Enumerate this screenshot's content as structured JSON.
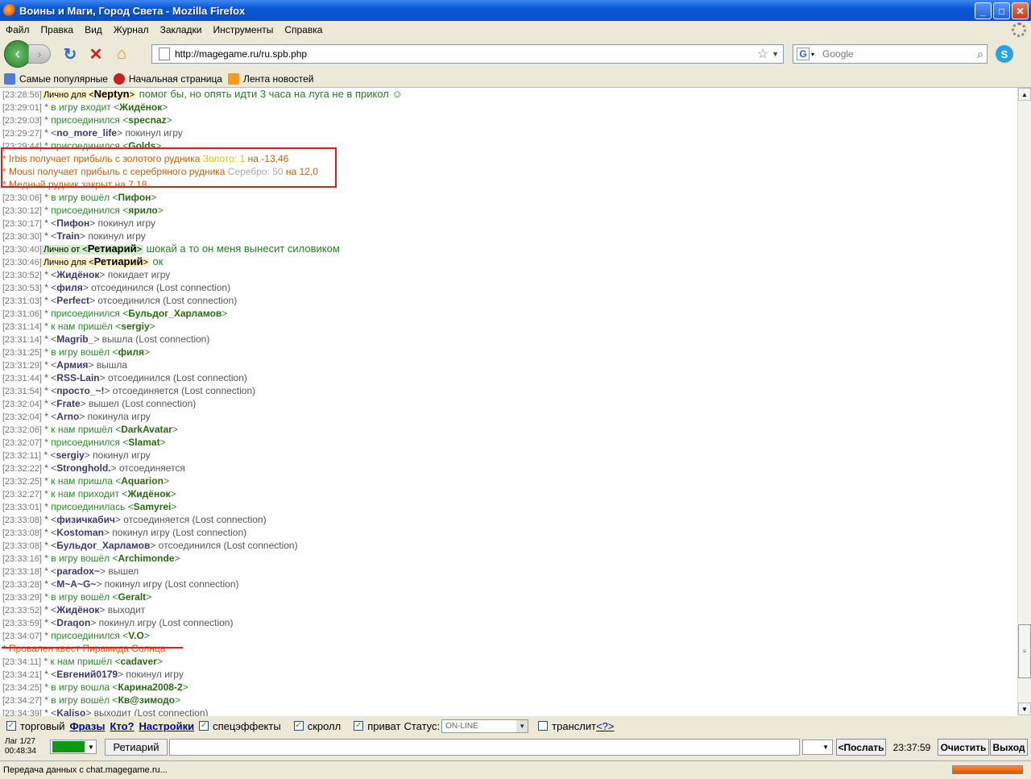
{
  "window": {
    "title": "Воины и Маги, Город Света - Mozilla Firefox",
    "minimize": "_",
    "maximize": "□",
    "close": "✕"
  },
  "menu": [
    "Файл",
    "Правка",
    "Вид",
    "Журнал",
    "Закладки",
    "Инструменты",
    "Справка"
  ],
  "nav": {
    "url": "http://magegame.ru/ru.spb.php",
    "search_placeholder": "Google"
  },
  "bookmarks": [
    "Самые популярные",
    "Начальная страница",
    "Лента новостей"
  ],
  "chat": [
    {
      "ts": "[23:28:56]",
      "type": "private_to",
      "label": "Лично для <",
      "nick": "Neptyn",
      "close": ">",
      "msg": " помог бы, но опять идти 3 часа на луга не в прикол ☺"
    },
    {
      "ts": "[23:29:01]",
      "type": "event",
      "pre": " * в игру входит <",
      "nick": "Жидёнок",
      "post": ">",
      "color": "green"
    },
    {
      "ts": "[23:29:03]",
      "type": "event",
      "pre": " * присоединился <",
      "nick": "specnaz",
      "post": ">",
      "color": "green"
    },
    {
      "ts": "[23:29:27]",
      "type": "event",
      "pre": " * <",
      "nick": "no_more_life",
      "post": "> покинул игру",
      "color": "gray"
    },
    {
      "ts": "[23:29:44]",
      "type": "event",
      "pre": " * присоединился <",
      "nick": "Golds",
      "post": ">",
      "color": "green"
    },
    {
      "ts": "",
      "type": "system",
      "text": "* Irbis получает прибыль с золотого рудника ",
      "hl": "Золото: 1",
      "hlclass": "gold",
      "tail": " на -13,46"
    },
    {
      "ts": "",
      "type": "system",
      "text": "* Mousi получает прибыль с серебряного рудника ",
      "hl": "Серебро: 50",
      "hlclass": "silver",
      "tail": " на 12,0"
    },
    {
      "ts": "",
      "type": "system",
      "text": "* Медный рудник закрыт на 7.18",
      "hl": "",
      "hlclass": "",
      "tail": ""
    },
    {
      "ts": "[23:30:06]",
      "type": "event",
      "pre": " * в игру вошёл <",
      "nick": "Пифон",
      "post": ">",
      "color": "green"
    },
    {
      "ts": "[23:30:12]",
      "type": "event",
      "pre": " * присоединился <",
      "nick": "ярило",
      "post": ">",
      "color": "green"
    },
    {
      "ts": "[23:30:17]",
      "type": "event",
      "pre": " * <",
      "nick": "Пифон",
      "post": "> покинул игру",
      "color": "gray"
    },
    {
      "ts": "[23:30:30]",
      "type": "event",
      "pre": " * <",
      "nick": "Train",
      "post": "> покинул игру",
      "color": "gray"
    },
    {
      "ts": "[23:30:40]",
      "type": "private_from",
      "label": "Лично от <",
      "nick": "Ретиарий",
      "close": ">",
      "msg": " шокай а то он меня вынесит силовиком"
    },
    {
      "ts": "[23:30:46]",
      "type": "private_to",
      "label": "Лично для <",
      "nick": "Ретиарий",
      "close": ">",
      "msg": " ок"
    },
    {
      "ts": "[23:30:52]",
      "type": "event",
      "pre": " * <",
      "nick": "Жидёнок",
      "post": "> покидает игру",
      "color": "gray"
    },
    {
      "ts": "[23:30:53]",
      "type": "event",
      "pre": " * <",
      "nick": "филя",
      "post": "> отсоединился (Lost connection)",
      "color": "gray"
    },
    {
      "ts": "[23:31:03]",
      "type": "event",
      "pre": " * <",
      "nick": "Perfect",
      "post": "> отсоединился (Lost connection)",
      "color": "gray"
    },
    {
      "ts": "[23:31:06]",
      "type": "event",
      "pre": " * присоединился <",
      "nick": "Бульдог_Харламов",
      "post": ">",
      "color": "green"
    },
    {
      "ts": "[23:31:14]",
      "type": "event",
      "pre": " * к нам пришёл <",
      "nick": "sergiy",
      "post": ">",
      "color": "green"
    },
    {
      "ts": "[23:31:14]",
      "type": "event",
      "pre": " * <",
      "nick": "Magrib_",
      "post": "> вышла (Lost connection)",
      "color": "gray"
    },
    {
      "ts": "[23:31:25]",
      "type": "event",
      "pre": " * в игру вошёл <",
      "nick": "филя",
      "post": ">",
      "color": "green"
    },
    {
      "ts": "[23:31:29]",
      "type": "event",
      "pre": " * <",
      "nick": "Армия",
      "post": "> вышла",
      "color": "gray"
    },
    {
      "ts": "[23:31:44]",
      "type": "event",
      "pre": " * <",
      "nick": "RSS-Lain",
      "post": "> отсоединился (Lost connection)",
      "color": "gray"
    },
    {
      "ts": "[23:31:54]",
      "type": "event",
      "pre": " * <",
      "nick": "просто_~!",
      "post": "> отсоединяется (Lost connection)",
      "color": "gray"
    },
    {
      "ts": "[23:32:04]",
      "type": "event",
      "pre": " * <",
      "nick": "Frate",
      "post": "> вышел (Lost connection)",
      "color": "gray"
    },
    {
      "ts": "[23:32:04]",
      "type": "event",
      "pre": " * <",
      "nick": "Arno",
      "post": "> покинула игру",
      "color": "gray"
    },
    {
      "ts": "[23:32:06]",
      "type": "event",
      "pre": " * к нам пришёл <",
      "nick": "DarkAvatar",
      "post": ">",
      "color": "green"
    },
    {
      "ts": "[23:32:07]",
      "type": "event",
      "pre": " * присоединился <",
      "nick": "Slamat",
      "post": ">",
      "color": "green"
    },
    {
      "ts": "[23:32:11]",
      "type": "event",
      "pre": " * <",
      "nick": "sergiy",
      "post": "> покинул игру",
      "color": "gray"
    },
    {
      "ts": "[23:32:22]",
      "type": "event",
      "pre": " * <",
      "nick": "Stronghold.",
      "post": "> отсоединяется",
      "color": "gray"
    },
    {
      "ts": "[23:32:25]",
      "type": "event",
      "pre": " * к нам пришла <",
      "nick": "Aquarion",
      "post": ">",
      "color": "green"
    },
    {
      "ts": "[23:32:27]",
      "type": "event",
      "pre": " * к нам приходит <",
      "nick": "Жидёнок",
      "post": ">",
      "color": "green"
    },
    {
      "ts": "[23:33:01]",
      "type": "event",
      "pre": " * присоединилась <",
      "nick": "Samyrei",
      "post": ">",
      "color": "green"
    },
    {
      "ts": "[23:33:08]",
      "type": "event",
      "pre": " * <",
      "nick": "физичкабич",
      "post": "> отсоединяется (Lost connection)",
      "color": "gray"
    },
    {
      "ts": "[23:33:08]",
      "type": "event",
      "pre": " * <",
      "nick": "Kostoman",
      "post": "> покинул игру (Lost connection)",
      "color": "gray"
    },
    {
      "ts": "[23:33:08]",
      "type": "event",
      "pre": " * <",
      "nick": "Бульдог_Харламов",
      "post": "> отсоединился (Lost connection)",
      "color": "gray"
    },
    {
      "ts": "[23:33:16]",
      "type": "event",
      "pre": " * в игру вошёл <",
      "nick": "Archimonde",
      "post": ">",
      "color": "green"
    },
    {
      "ts": "[23:33:18]",
      "type": "event",
      "pre": " * <",
      "nick": "paradox~",
      "post": "> вышел",
      "color": "gray"
    },
    {
      "ts": "[23:33:28]",
      "type": "event",
      "pre": " * <",
      "nick": "M~A~G~",
      "post": "> покинул игру (Lost connection)",
      "color": "gray"
    },
    {
      "ts": "[23:33:29]",
      "type": "event",
      "pre": " * в игру вошёл <",
      "nick": "Geralt",
      "post": ">",
      "color": "green"
    },
    {
      "ts": "[23:33:52]",
      "type": "event",
      "pre": " * <",
      "nick": "Жидёнок",
      "post": "> выходит",
      "color": "gray"
    },
    {
      "ts": "[23:33:59]",
      "type": "event",
      "pre": " * <",
      "nick": "Draqon",
      "post": "> покинул игру (Lost connection)",
      "color": "gray"
    },
    {
      "ts": "[23:34:07]",
      "type": "event",
      "pre": " * присоединился <",
      "nick": "V.O",
      "post": ">",
      "color": "green"
    },
    {
      "ts": "",
      "type": "system",
      "text": "* Провален квест Пирамида Солнца",
      "hl": "",
      "hlclass": "",
      "tail": ""
    },
    {
      "ts": "[23:34:11]",
      "type": "event",
      "pre": " * к нам пришёл <",
      "nick": "cadaver",
      "post": ">",
      "color": "green"
    },
    {
      "ts": "[23:34:21]",
      "type": "event",
      "pre": " * <",
      "nick": "Евгений0179",
      "post": "> покинул игру",
      "color": "gray"
    },
    {
      "ts": "[23:34:25]",
      "type": "event",
      "pre": " * в игру вошла <",
      "nick": "Карина2008-2",
      "post": ">",
      "color": "green"
    },
    {
      "ts": "[23:34:27]",
      "type": "event",
      "pre": " * в игру вошёл <",
      "nick": "Кв@зимодо",
      "post": ">",
      "color": "green"
    },
    {
      "ts": "[23:34:39]",
      "type": "event",
      "pre": " * <",
      "nick": "Kaliso",
      "post": "> выходит (Lost connection)",
      "color": "gray"
    }
  ],
  "controls": {
    "trade": "торговый",
    "phrases": "Фразы",
    "who": "Кто?",
    "settings": "Настройки",
    "effects": "спецэффекты",
    "scroll": "скролл",
    "privat": "приват",
    "status_label": "Статус:",
    "status_value": "ON-LINE",
    "translit": "транслит",
    "translit_help": "<?>"
  },
  "input": {
    "lag": "Лаг 1/27",
    "session_time": "00:48:34",
    "nick": "Ретиарий",
    "send": "<Послать",
    "clock": "23:37:59",
    "clear": "Очистить",
    "exit": "Выход"
  },
  "status": {
    "text": "Передача данных с chat.magegame.ru..."
  },
  "colors": {
    "nick_green": "#2a6a10",
    "nick_gray": "#3a3a6a",
    "system": "#c8600a",
    "selected_color": "#0c9a12"
  }
}
